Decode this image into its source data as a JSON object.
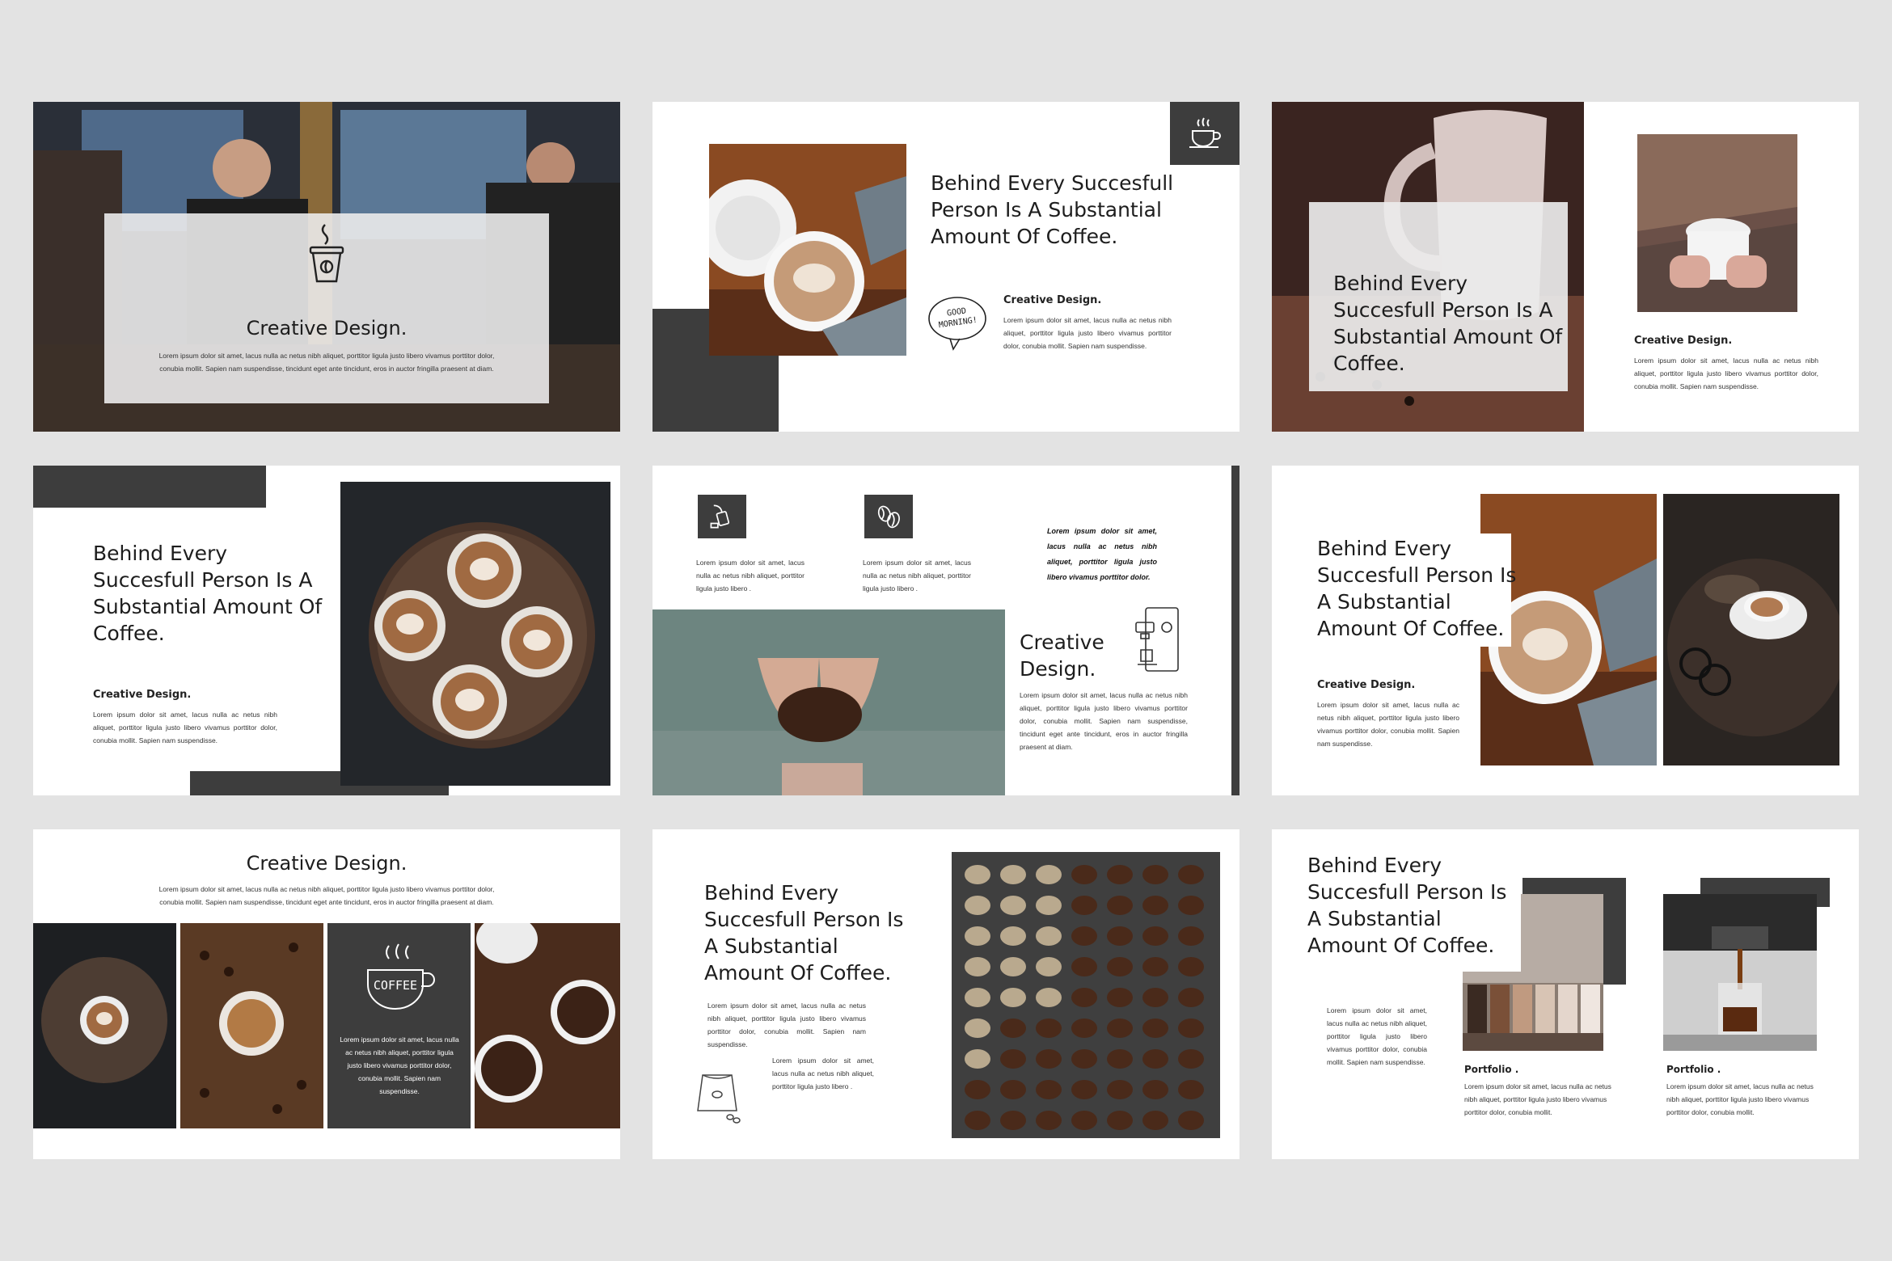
{
  "slides": {
    "s1": {
      "title": "Creative Design.",
      "body": "Lorem ipsum dolor sit amet, lacus nulla ac netus nibh aliquet, porttitor ligula justo libero vivamus porttitor dolor, conubia mollit. Sapien nam suspendisse, tincidunt eget ante tincidunt, eros in auctor fringilla praesent at diam."
    },
    "s2": {
      "title": "Behind Every Succesfull Person Is A Substantial Amount Of Coffee.",
      "subtitle": "Creative Design.",
      "body": "Lorem ipsum dolor sit amet, lacus nulla ac netus nibh aliquet, porttitor ligula justo libero vivamus porttitor dolor, conubia mollit. Sapien nam suspendisse.",
      "doodle_text": "GOOD MORNING!"
    },
    "s3": {
      "title": "Behind Every Succesfull Person Is A Substantial Amount Of Coffee.",
      "subtitle": "Creative Design.",
      "body": "Lorem ipsum dolor sit amet, lacus nulla ac netus nibh aliquet, porttitor ligula justo libero vivamus porttitor dolor, conubia mollit. Sapien nam suspendisse."
    },
    "s4": {
      "title": "Behind Every Succesfull Person Is A Substantial Amount Of Coffee.",
      "subtitle": "Creative Design.",
      "body": "Lorem ipsum dolor sit amet, lacus nulla ac netus nibh aliquet, porttitor ligula justo libero vivamus porttitor dolor, conubia mollit. Sapien nam suspendisse."
    },
    "s5": {
      "col1": "Lorem ipsum dolor sit amet, lacus nulla ac netus nibh aliquet, porttitor ligula justo libero .",
      "col2": "Lorem ipsum dolor sit amet, lacus nulla ac netus nibh aliquet, porttitor ligula justo libero .",
      "quote": "Lorem ipsum dolor sit amet, lacus nulla ac netus nibh aliquet, porttitor ligula justo libero vivamus porttitor dolor.",
      "title": "Creative Design.",
      "body": "Lorem ipsum dolor sit amet, lacus nulla ac netus nibh aliquet, porttitor ligula justo libero vivamus porttitor dolor, conubia mollit. Sapien nam suspendisse, tincidunt eget ante tincidunt, eros in auctor fringilla praesent at diam."
    },
    "s6": {
      "title": "Behind Every Succesfull Person Is A Substantial Amount Of Coffee.",
      "subtitle": "Creative Design.",
      "body": "Lorem ipsum dolor sit amet, lacus nulla ac netus nibh aliquet, porttitor ligula justo libero vivamus porttitor dolor, conubia mollit. Sapien nam suspendisse."
    },
    "s7": {
      "title": "Creative Design.",
      "body": "Lorem ipsum dolor sit amet, lacus nulla ac netus nibh aliquet, porttitor ligula justo libero vivamus porttitor dolor, conubia mollit. Sapien nam suspendisse, tincidunt eget ante tincidunt, eros in auctor fringilla praesent at diam.",
      "panel_body": "Lorem ipsum dolor sit amet, lacus nulla ac netus nibh aliquet, porttitor ligula justo libero vivamus porttitor dolor, conubia mollit. Sapien nam suspendisse.",
      "cup_text": "COFFEE"
    },
    "s8": {
      "title": "Behind Every Succesfull Person Is A Substantial Amount Of Coffee.",
      "body": "Lorem ipsum dolor sit amet, lacus nulla ac netus nibh aliquet, porttitor ligula justo libero vivamus porttitor dolor, conubia mollit. Sapien nam suspendisse.",
      "body2": "Lorem ipsum dolor sit amet, lacus nulla ac netus nibh aliquet, porttitor ligula justo libero ."
    },
    "s9": {
      "title": "Behind Every Succesfull Person Is A Substantial Amount Of Coffee.",
      "body": "Lorem ipsum dolor sit amet, lacus nulla ac netus nibh aliquet, porttitor ligula justo libero vivamus porttitor dolor, conubia mollit. Sapien nam suspendisse.",
      "p1_label": "Portfolio .",
      "p1_body": "Lorem ipsum dolor sit amet, lacus nulla ac netus nibh aliquet, porttitor ligula justo libero vivamus porttitor dolor, conubia mollit.",
      "p2_label": "Portfolio .",
      "p2_body": "Lorem ipsum dolor sit amet, lacus nulla ac netus nibh aliquet, porttitor ligula justo libero vivamus porttitor dolor, conubia mollit."
    }
  },
  "colors": {
    "background": "#e3e3e3",
    "slide": "#ffffff",
    "accent_dark": "#3d3d3d"
  },
  "icons": [
    "coffee-cup-icon",
    "takeaway-cup-icon",
    "tea-bag-icon",
    "coffee-bean-icon",
    "espresso-machine-icon",
    "coffee-bag-icon",
    "coffee-mug-icon"
  ]
}
